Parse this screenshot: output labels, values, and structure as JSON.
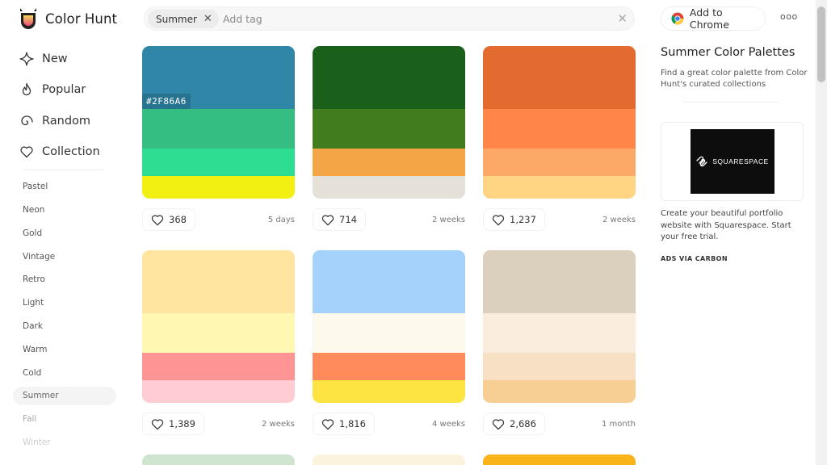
{
  "app": {
    "name": "Color Hunt"
  },
  "search": {
    "tag": "Summer",
    "placeholder": "Add tag"
  },
  "header": {
    "chrome_label": "Add to Chrome",
    "more_label": "ooo"
  },
  "sidebar": {
    "nav": [
      {
        "label": "New",
        "icon": "sparkle-icon"
      },
      {
        "label": "Popular",
        "icon": "flame-icon"
      },
      {
        "label": "Random",
        "icon": "spiral-icon"
      },
      {
        "label": "Collection",
        "icon": "heart-icon"
      }
    ],
    "tags": [
      "Pastel",
      "Neon",
      "Gold",
      "Vintage",
      "Retro",
      "Light",
      "Dark",
      "Warm",
      "Cold",
      "Summer",
      "Fall",
      "Winter"
    ],
    "active_tag": "Summer"
  },
  "palettes": [
    {
      "colors": [
        "#2F86A6",
        "#34BE82",
        "#2FDD92",
        "#F2F013"
      ],
      "hex_label": "#2F86A6",
      "likes": "368",
      "date": "5 days"
    },
    {
      "colors": [
        "#1A5F1A",
        "#417D1E",
        "#F4A545",
        "#E6E1D8"
      ],
      "likes": "714",
      "date": "2 weeks"
    },
    {
      "colors": [
        "#E46B2F",
        "#FF8548",
        "#FCA968",
        "#FFD483"
      ],
      "likes": "1,237",
      "date": "2 weeks"
    },
    {
      "colors": [
        "#FFE59F",
        "#FFF7B2",
        "#FF9494",
        "#FFCCD3"
      ],
      "likes": "1,389",
      "date": "2 weeks"
    },
    {
      "colors": [
        "#A4D2FB",
        "#FDF9EC",
        "#FF8A5B",
        "#FDE443"
      ],
      "likes": "1,816",
      "date": "4 weeks"
    },
    {
      "colors": [
        "#DBCFBE",
        "#FAEDDD",
        "#F7E0C3",
        "#F7CE94"
      ],
      "likes": "2,686",
      "date": "1 month"
    }
  ],
  "next_row_colors": [
    "#CFE5CF",
    "#FBF3DE",
    "#F8B418"
  ],
  "right_panel": {
    "title": "Summer Color Palettes",
    "description": "Find a great color palette from Color Hunt's curated collections",
    "ad_brand": "SQUARESPACE",
    "ad_text": "Create your beautiful portfolio website with Squarespace. Start your free trial.",
    "ad_via": "ADS VIA CARBON"
  }
}
